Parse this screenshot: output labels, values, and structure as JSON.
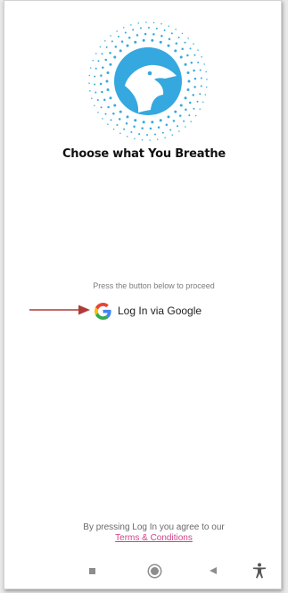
{
  "app": {
    "title": "Choose what You Breathe"
  },
  "login": {
    "hint": "Press the button below to proceed",
    "button_label": "Log In via Google"
  },
  "footer": {
    "agree_text": "By pressing Log In you agree to our",
    "terms_link": "Terms & Conditions"
  },
  "navbar": {
    "items": [
      "recent-apps-icon",
      "home-icon",
      "back-icon",
      "accessibility-icon"
    ]
  },
  "colors": {
    "brand_blue": "#35a8e0",
    "terms_pink": "#d1418a",
    "arrow_red": "#b03a3a"
  },
  "icons": {
    "logo": "eagle-head-dotted-circle-logo",
    "google": "google-g-icon",
    "arrow": "red-arrow-annotation"
  }
}
